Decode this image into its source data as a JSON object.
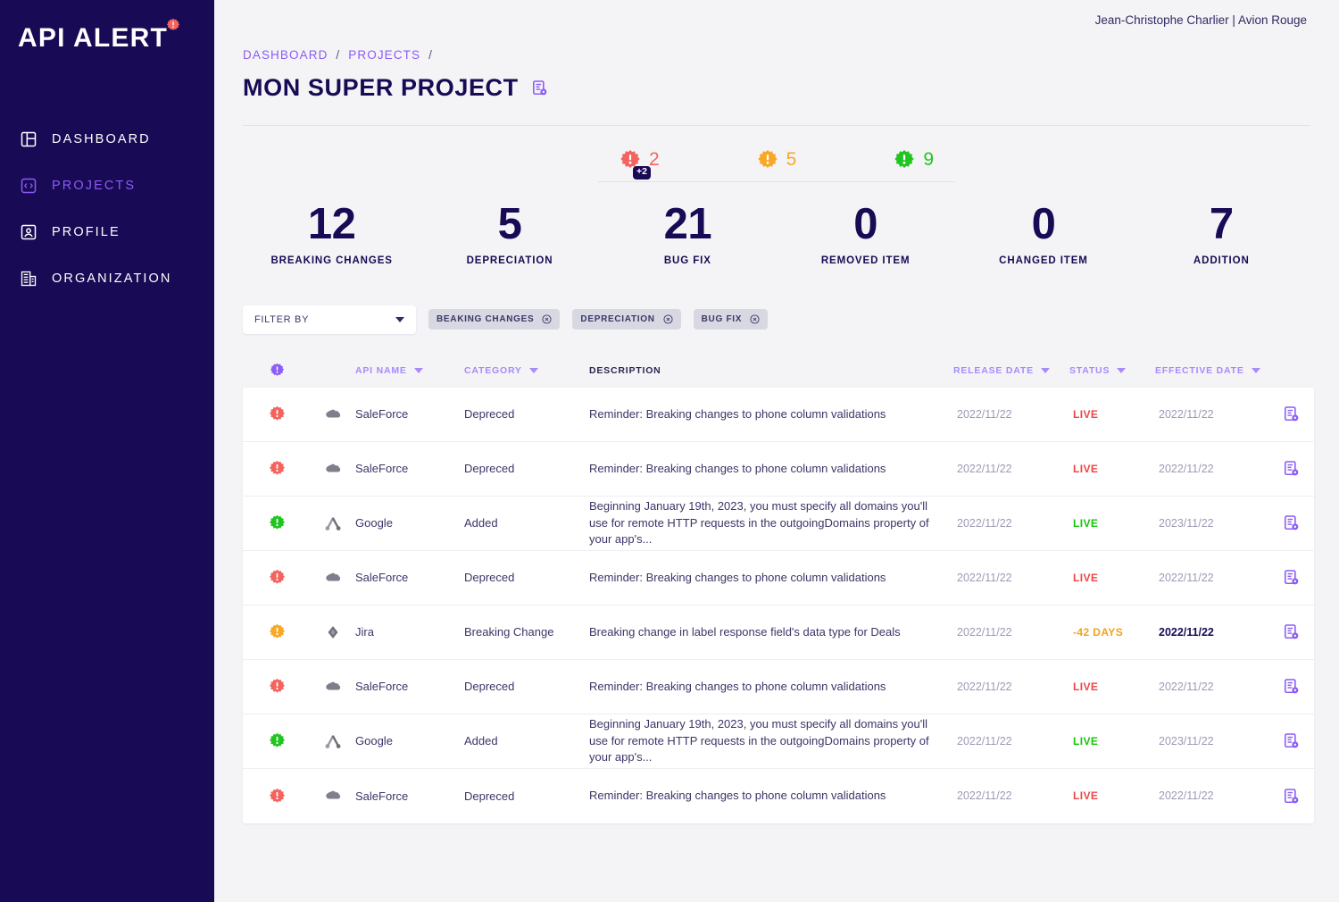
{
  "brand": {
    "name": "API ALERT",
    "logo_icon": "gear-alert-icon"
  },
  "sidebar": {
    "items": [
      {
        "label": "DASHBOARD",
        "icon": "layout-panel-icon",
        "active": false
      },
      {
        "label": "PROJECTS",
        "icon": "code-brackets-icon",
        "active": true
      },
      {
        "label": "PROFILE",
        "icon": "user-card-icon",
        "active": false
      },
      {
        "label": "ORGANIZATION",
        "icon": "building-icon",
        "active": false
      }
    ]
  },
  "topbar": {
    "user": "Jean-Christophe Charlier | Avion Rouge"
  },
  "breadcrumb": {
    "items": [
      "DASHBOARD",
      "PROJECTS"
    ],
    "separator": "/"
  },
  "header": {
    "title": "MON SUPER PROJECT",
    "title_icon": "document-gear-icon"
  },
  "severity_badges": [
    {
      "icon": "gear-alert-icon",
      "color": "#f4645f",
      "count": "2",
      "extra": "+2"
    },
    {
      "icon": "gear-alert-icon",
      "color": "#f9a825",
      "count": "5",
      "extra": ""
    },
    {
      "icon": "gear-alert-icon",
      "color": "#21c521",
      "count": "9",
      "extra": ""
    }
  ],
  "stats": [
    {
      "value": "12",
      "label": "BREAKING CHANGES"
    },
    {
      "value": "5",
      "label": "DEPRECIATION"
    },
    {
      "value": "21",
      "label": "BUG FIX"
    },
    {
      "value": "0",
      "label": "REMOVED ITEM"
    },
    {
      "value": "0",
      "label": "CHANGED ITEM"
    },
    {
      "value": "7",
      "label": "ADDITION"
    }
  ],
  "filter": {
    "select_label": "FILTER BY",
    "chips": [
      {
        "label": "BEAKING CHANGES",
        "remove_icon": "close-circle-icon"
      },
      {
        "label": "DEPRECIATION",
        "remove_icon": "close-circle-icon"
      },
      {
        "label": "BUG FIX",
        "remove_icon": "close-circle-icon"
      }
    ]
  },
  "table": {
    "columns": {
      "gear": "",
      "api_name": "API NAME",
      "category": "CATEGORY",
      "description": "DESCRIPTION",
      "release_date": "RELEASE DATE",
      "status": "STATUS",
      "effective_date": "EFFECTIVE DATE"
    },
    "header_icon": "gear-alert-icon",
    "rows": [
      {
        "severity_color": "#f4645f",
        "brand_icon": "salesforce-cloud-icon",
        "api_name": "SaleForce",
        "category": "Depreced",
        "description": "Reminder: Breaking changes to phone column validations",
        "release_date": "2022/11/22",
        "status": "LIVE",
        "status_color": "#ef4444",
        "effective_date": "2022/11/22",
        "effective_dark": false,
        "action_icon": "document-gear-icon"
      },
      {
        "severity_color": "#f4645f",
        "brand_icon": "salesforce-cloud-icon",
        "api_name": "SaleForce",
        "category": "Depreced",
        "description": "Reminder: Breaking changes to phone column validations",
        "release_date": "2022/11/22",
        "status": "LIVE",
        "status_color": "#ef4444",
        "effective_date": "2022/11/22",
        "effective_dark": false,
        "action_icon": "document-gear-icon"
      },
      {
        "severity_color": "#21c521",
        "brand_icon": "google-ads-icon",
        "api_name": "Google",
        "category": "Added",
        "description": "Beginning January 19th, 2023, you must specify all domains you'll use for remote HTTP requests in the outgoingDomains property of your app's...",
        "release_date": "2022/11/22",
        "status": "LIVE",
        "status_color": "#16c60c",
        "effective_date": "2023/11/22",
        "effective_dark": false,
        "action_icon": "document-gear-icon"
      },
      {
        "severity_color": "#f4645f",
        "brand_icon": "salesforce-cloud-icon",
        "api_name": "SaleForce",
        "category": "Depreced",
        "description": "Reminder: Breaking changes to phone column validations",
        "release_date": "2022/11/22",
        "status": "LIVE",
        "status_color": "#ef4444",
        "effective_date": "2022/11/22",
        "effective_dark": false,
        "action_icon": "document-gear-icon"
      },
      {
        "severity_color": "#f9a825",
        "brand_icon": "jira-diamond-icon",
        "api_name": "Jira",
        "category": "Breaking Change",
        "description": "Breaking change in label response field's data type for Deals",
        "release_date": "2022/11/22",
        "status": "-42 DAYS",
        "status_color": "#f2a317",
        "effective_date": "2022/11/22",
        "effective_dark": true,
        "action_icon": "document-gear-icon"
      },
      {
        "severity_color": "#f4645f",
        "brand_icon": "salesforce-cloud-icon",
        "api_name": "SaleForce",
        "category": "Depreced",
        "description": "Reminder: Breaking changes to phone column validations",
        "release_date": "2022/11/22",
        "status": "LIVE",
        "status_color": "#ef4444",
        "effective_date": "2022/11/22",
        "effective_dark": false,
        "action_icon": "document-gear-icon"
      },
      {
        "severity_color": "#21c521",
        "brand_icon": "google-ads-icon",
        "api_name": "Google",
        "category": "Added",
        "description": "Beginning January 19th, 2023, you must specify all domains you'll use for remote HTTP requests in the outgoingDomains property of your app's...",
        "release_date": "2022/11/22",
        "status": "LIVE",
        "status_color": "#16c60c",
        "effective_date": "2023/11/22",
        "effective_dark": false,
        "action_icon": "document-gear-icon"
      },
      {
        "severity_color": "#f4645f",
        "brand_icon": "salesforce-cloud-icon",
        "api_name": "SaleForce",
        "category": "Depreced",
        "description": "Reminder: Breaking changes to phone column validations",
        "release_date": "2022/11/22",
        "status": "LIVE",
        "status_color": "#ef4444",
        "effective_date": "2022/11/22",
        "effective_dark": false,
        "action_icon": "document-gear-icon"
      }
    ]
  },
  "colors": {
    "sidebar_bg": "#180a54",
    "accent_purple": "#8b5cf6",
    "page_bg": "#f4f4f6",
    "navy": "#180a54"
  }
}
